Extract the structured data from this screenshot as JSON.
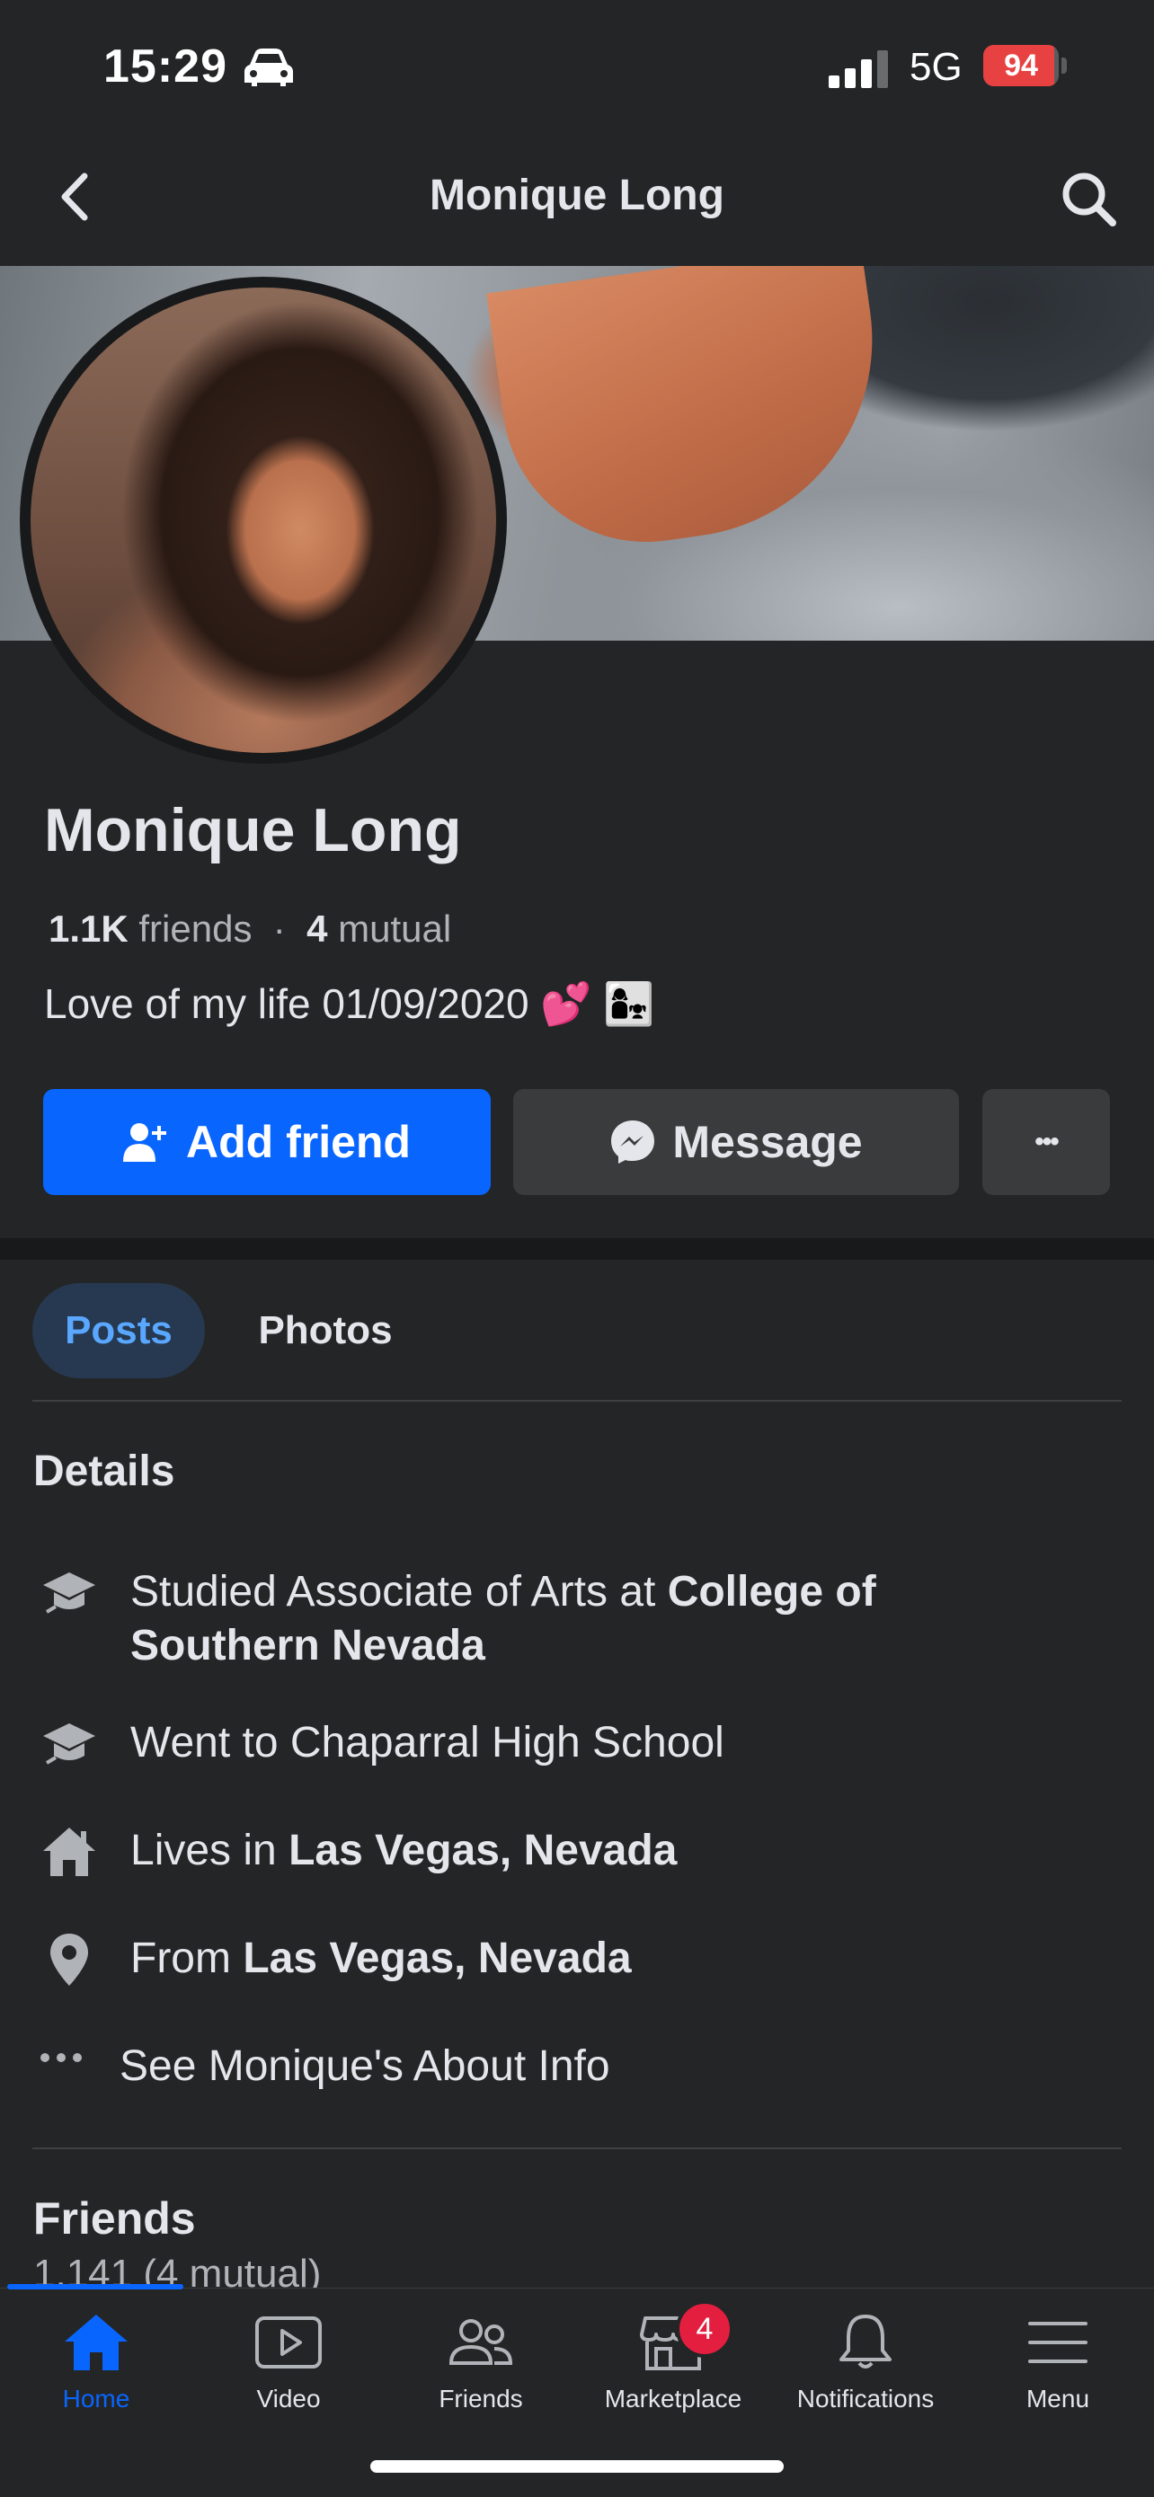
{
  "status_bar": {
    "time": "15:29",
    "network": "5G",
    "battery": "94",
    "battery_level": 0.94
  },
  "header": {
    "title": "Monique Long"
  },
  "profile": {
    "name": "Monique Long",
    "friends_count": "1.1K",
    "friends_label": "friends",
    "separator": "·",
    "mutual_count": "4",
    "mutual_label": "mutual",
    "bio": "Love of my life 01/09/2020 💕 👩‍👧"
  },
  "actions": {
    "add_friend": "Add friend",
    "message": "Message",
    "more": "•••"
  },
  "tabs": [
    {
      "label": "Posts",
      "active": true
    },
    {
      "label": "Photos",
      "active": false
    }
  ],
  "details": {
    "heading": "Details",
    "items": [
      {
        "icon": "graduation-cap-icon",
        "prefix": "Studied Associate of Arts at ",
        "bold": "College of Southern Nevada"
      },
      {
        "icon": "graduation-cap-icon",
        "prefix": "Went to Chaparral High School",
        "bold": ""
      },
      {
        "icon": "home-icon",
        "prefix": "Lives in ",
        "bold": "Las Vegas, Nevada"
      },
      {
        "icon": "location-pin-icon",
        "prefix": "From ",
        "bold": "Las Vegas, Nevada"
      },
      {
        "icon": "more-dots-icon",
        "prefix": "See Monique's About Info",
        "bold": ""
      }
    ]
  },
  "friends_section": {
    "heading": "Friends",
    "count": "1,141 (4 mutual)"
  },
  "bottom_nav": {
    "items": [
      {
        "label": "Home",
        "icon": "home-icon",
        "active": true
      },
      {
        "label": "Video",
        "icon": "video-icon",
        "active": false
      },
      {
        "label": "Friends",
        "icon": "friends-icon",
        "active": false
      },
      {
        "label": "Marketplace",
        "icon": "marketplace-icon",
        "active": false,
        "badge": "4"
      },
      {
        "label": "Notifications",
        "icon": "bell-icon",
        "active": false
      },
      {
        "label": "Menu",
        "icon": "menu-icon",
        "active": false
      }
    ]
  },
  "colors": {
    "background": "#242526",
    "accent": "#0866ff",
    "badge": "#e41e3f",
    "text": "#e4e6eb",
    "muted": "#b0b3b8"
  }
}
